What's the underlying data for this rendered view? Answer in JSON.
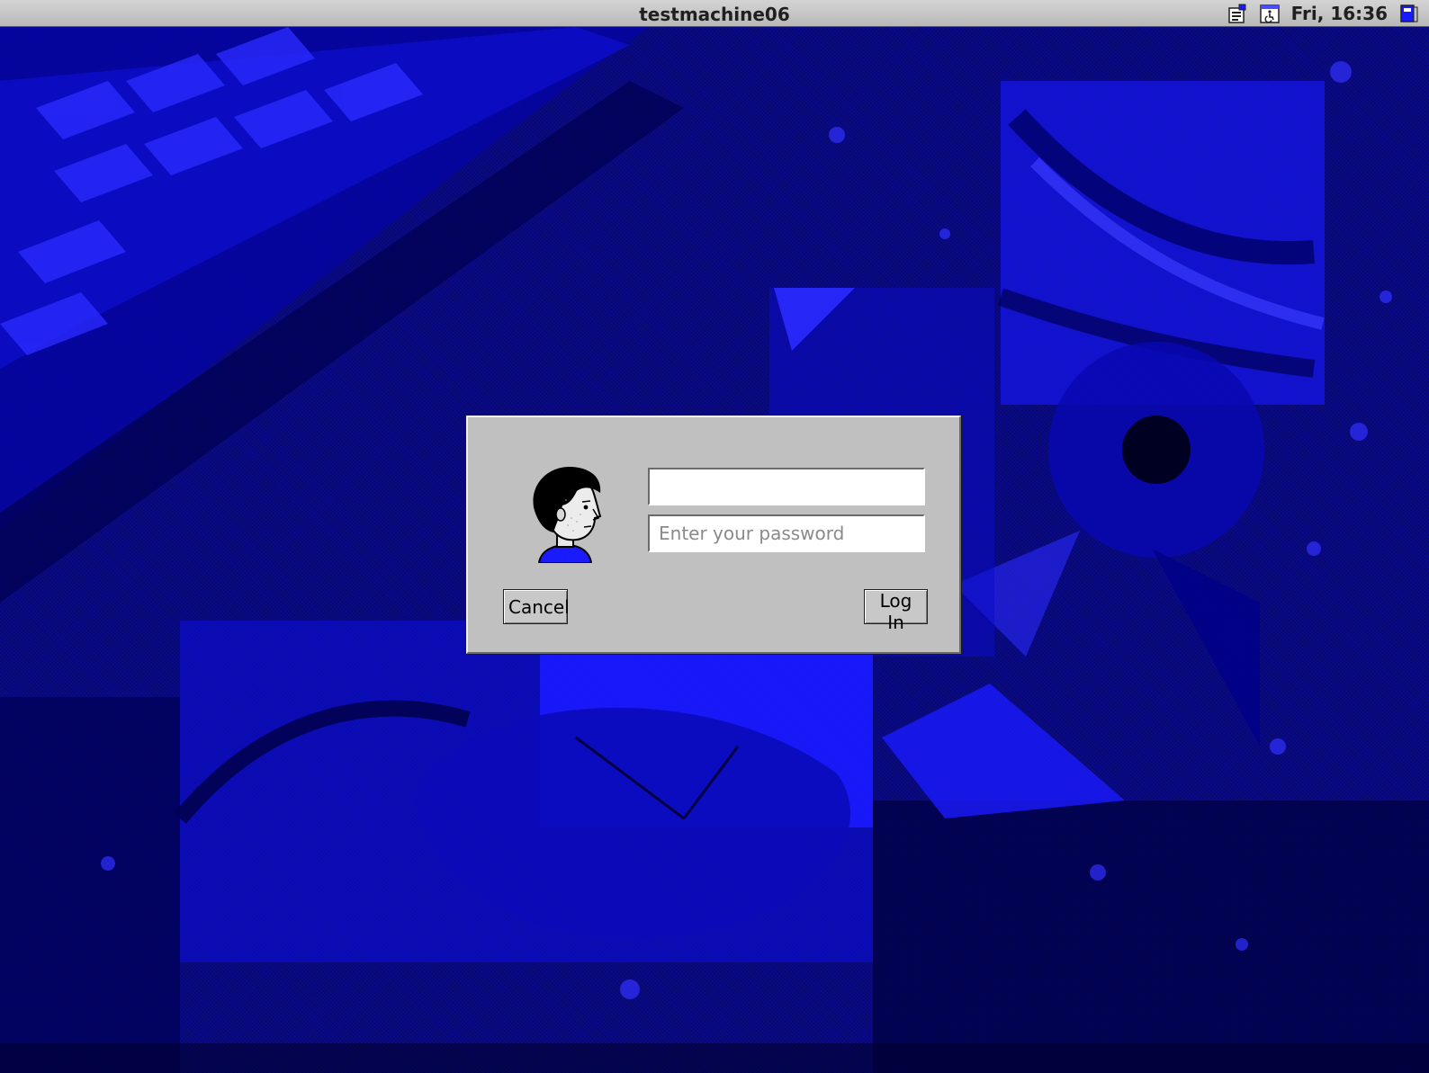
{
  "topbar": {
    "hostname": "testmachine06",
    "clock": "Fri, 16:36",
    "icons": [
      "network-status-icon",
      "accessibility-icon",
      "session-menu-icon"
    ]
  },
  "wallpaper": {
    "theme": "blue dithered computer hardware montage",
    "colors": {
      "base": "#0a0a8a",
      "bright": "#1a1aff",
      "dark": "#000000"
    }
  },
  "dialog": {
    "username_value": "",
    "password_placeholder": "Enter your password",
    "cancel_label": "Cancel",
    "login_label": "Log In",
    "avatar_icon": "user-face-icon",
    "colors": {
      "panel": "#c0c0c0",
      "field": "#ffffff"
    }
  }
}
